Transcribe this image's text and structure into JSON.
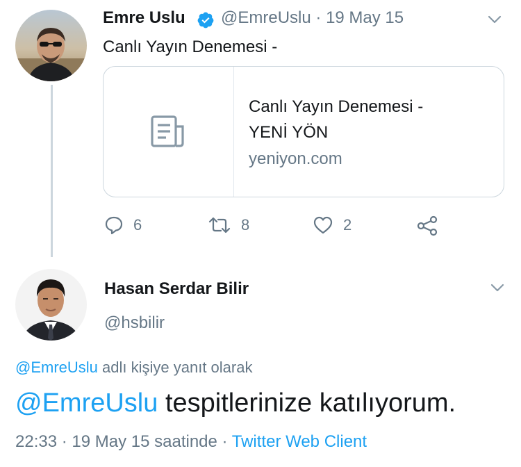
{
  "tweet": {
    "author_name": "Emre Uslu",
    "handle": "@EmreUslu",
    "separator": "·",
    "date": "19 May 15",
    "text": "Canlı Yayın Denemesi -",
    "card": {
      "title_line1": "Canlı Yayın Denemesi -",
      "title_line2": "YENİ YÖN",
      "domain": "yeniyon.com",
      "icon": "document-icon"
    },
    "actions": {
      "reply_count": "6",
      "retweet_count": "8",
      "like_count": "2"
    }
  },
  "reply": {
    "author_name": "Hasan Serdar Bilir",
    "handle": "@hsbilir",
    "reply_to_handle": "@EmreUslu",
    "reply_to_suffix": "adlı kişiye yanıt olarak",
    "mention": "@EmreUslu",
    "text": "tespitlerinize katılıyorum.",
    "time": "22:33",
    "date_suffix": "· 19 May 15 saatinde ·",
    "client": "Twitter Web Client"
  },
  "colors": {
    "link": "#1da1f2",
    "muted": "#657786",
    "text": "#14171a",
    "border": "#ccd6dd"
  }
}
